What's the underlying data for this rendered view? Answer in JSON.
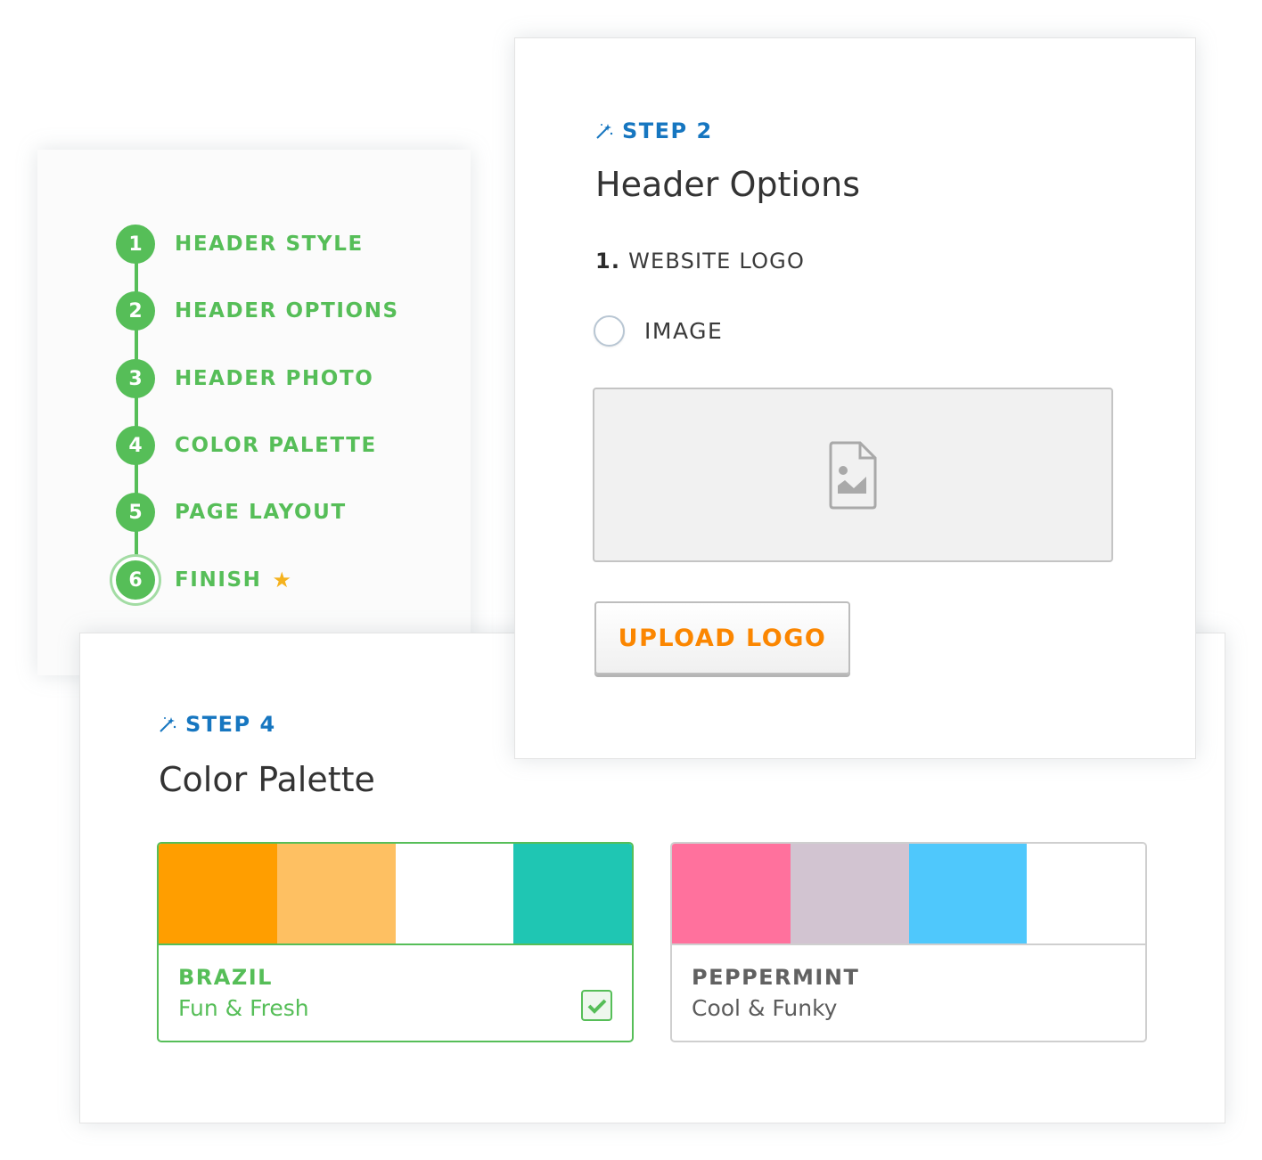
{
  "stepper": {
    "steps": [
      {
        "number": "1",
        "label": "HEADER STYLE"
      },
      {
        "number": "2",
        "label": "HEADER OPTIONS"
      },
      {
        "number": "3",
        "label": "HEADER PHOTO"
      },
      {
        "number": "4",
        "label": "COLOR PALETTE"
      },
      {
        "number": "5",
        "label": "PAGE LAYOUT"
      },
      {
        "number": "6",
        "label": "FINISH",
        "icon": "star-icon",
        "active": true
      }
    ],
    "color": "#56be58",
    "star_color": "#f5b21d"
  },
  "header_options": {
    "step_tag": "STEP 2",
    "title": "Header Options",
    "section_number": "1.",
    "section_label": "WEBSITE LOGO",
    "radio_label": "IMAGE",
    "radio_checked": false,
    "dropzone_icon": "image-file-icon",
    "upload_button": "UPLOAD LOGO",
    "accent": "#1676c0",
    "button_color": "#fb8600"
  },
  "color_palette": {
    "step_tag": "STEP 4",
    "title": "Color Palette",
    "palettes": [
      {
        "name": "BRAZIL",
        "description": "Fun & Fresh",
        "colors": [
          "#ff9e00",
          "#fec062",
          "#ffffff",
          "#1fc6b3"
        ],
        "selected": true
      },
      {
        "name": "PEPPERMINT",
        "description": "Cool & Funky",
        "colors": [
          "#ff719d",
          "#d2c4d1",
          "#4fc8fc",
          "#ffffff"
        ],
        "selected": false
      }
    ]
  }
}
